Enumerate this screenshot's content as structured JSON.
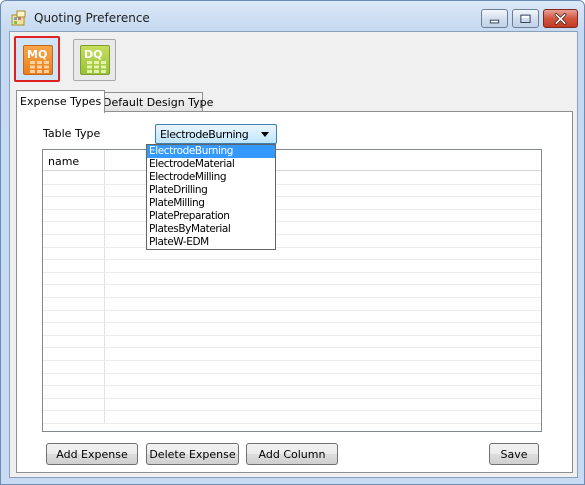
{
  "window": {
    "title": "Quoting Preference",
    "controls": [
      "minimize-icon",
      "maximize-icon",
      "close-icon"
    ]
  },
  "toolbar": {
    "buttons": [
      {
        "label": "MQ",
        "selected": true,
        "color": "#ea7f1c"
      },
      {
        "label": "DQ",
        "selected": false,
        "color": "#97c23a"
      }
    ]
  },
  "tabs": [
    {
      "label": "Expense Types",
      "active": true
    },
    {
      "label": "Default Design Type",
      "active": false
    }
  ],
  "form": {
    "table_type_label": "Table Type",
    "table_type_value": "ElectrodeBurning"
  },
  "dropdown": {
    "options": [
      "ElectrodeBurning",
      "ElectrodeMaterial",
      "ElectrodeMilling",
      "PlateDrilling",
      "PlateMilling",
      "PlatePreparation",
      "PlatesByMaterial",
      "PlateW-EDM"
    ],
    "selected_index": 0
  },
  "grid": {
    "columns": [
      "name"
    ]
  },
  "buttons": {
    "add_expense": "Add Expense",
    "delete_expense": "Delete Expense",
    "add_column": "Add Column",
    "save": "Save"
  },
  "colors": {
    "selection": "#3399ff",
    "highlight_border": "#e02020"
  }
}
